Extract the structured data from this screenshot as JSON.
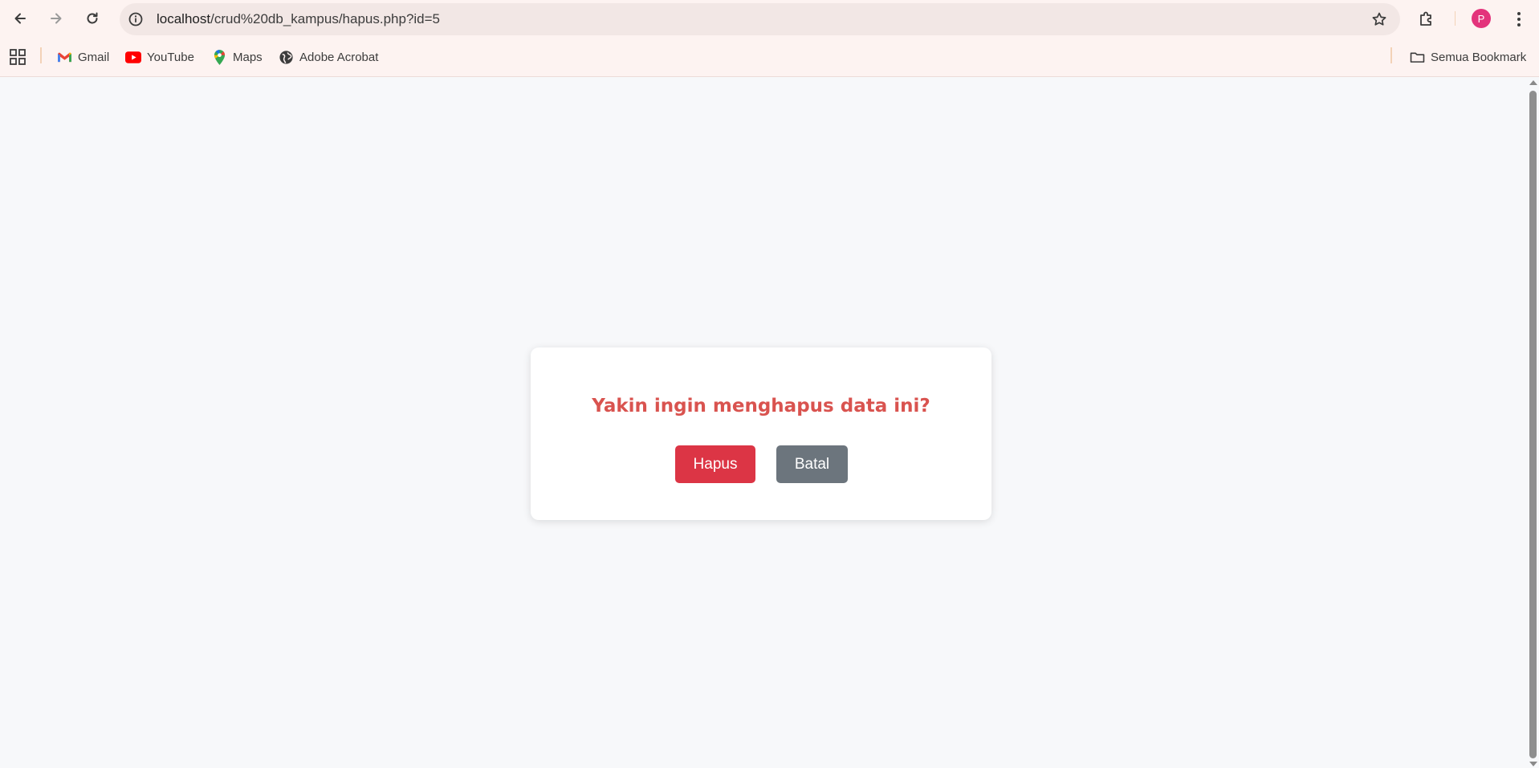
{
  "browser": {
    "url_host": "localhost",
    "url_path": "/crud%20db_kampus/hapus.php?id=5",
    "profile_initial": "P",
    "profile_color": "#e3337b",
    "icons": {
      "back": "back-arrow-icon",
      "forward": "forward-arrow-icon",
      "reload": "reload-icon",
      "site_info": "site-info-icon",
      "bookmark_star": "star-icon",
      "extensions": "puzzle-icon",
      "menu": "more-vert-icon"
    }
  },
  "bookmarks_bar": {
    "items": [
      {
        "label": "Gmail",
        "icon": "gmail-icon"
      },
      {
        "label": "YouTube",
        "icon": "youtube-icon"
      },
      {
        "label": "Maps",
        "icon": "maps-icon"
      },
      {
        "label": "Adobe Acrobat",
        "icon": "globe-icon"
      }
    ],
    "all_bookmarks": {
      "label": "Semua Bookmark",
      "icon": "folder-icon"
    }
  },
  "dialog": {
    "message": "Yakin ingin menghapus data ini?",
    "message_color": "#d9534f",
    "delete_label": "Hapus",
    "delete_color": "#dc3545",
    "cancel_label": "Batal",
    "cancel_color": "#6c757d"
  }
}
